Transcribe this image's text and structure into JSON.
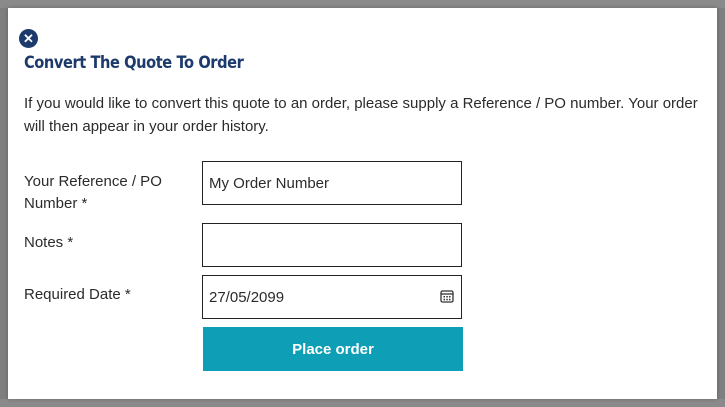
{
  "modal": {
    "close_symbol": "✕",
    "title": "Convert The Quote To Order",
    "description": "If you would like to convert this quote to an order, please supply a Reference / PO number. Your order will then appear in your order history."
  },
  "form": {
    "reference": {
      "label": "Your Reference / PO Number *",
      "value": "My Order Number"
    },
    "notes": {
      "label": "Notes *",
      "value": ""
    },
    "required_date": {
      "label": "Required Date *",
      "value": "27/05/2099",
      "icon": "calendar-icon"
    }
  },
  "actions": {
    "place_order_label": "Place order"
  },
  "colors": {
    "title": "#1c3a6b",
    "button": "#0e9fb6",
    "close": "#1c3a6b"
  }
}
